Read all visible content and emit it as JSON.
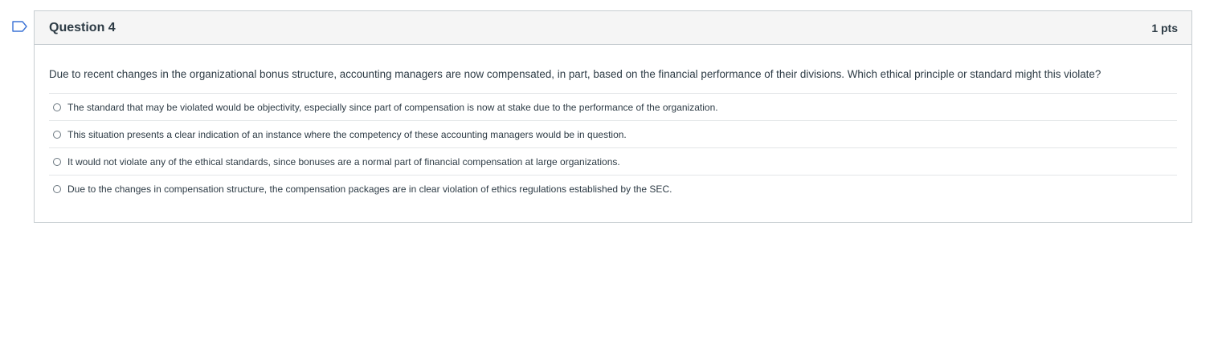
{
  "question": {
    "title": "Question 4",
    "points": "1 pts",
    "text": "Due to recent changes in the organizational bonus structure, accounting managers are now compensated, in part, based on the financial performance of their divisions. Which ethical principle or standard might this violate?",
    "answers": [
      {
        "label": "The standard that may be violated would be objectivity, especially since part of compensation is now at stake due to the performance of the organization."
      },
      {
        "label": "This situation presents a clear indication of an instance where the competency of these accounting managers would be in question."
      },
      {
        "label": "It would not violate any of the ethical standards, since bonuses are a normal part of financial compensation at large organizations."
      },
      {
        "label": "Due to the changes in compensation structure, the compensation packages are in clear violation of ethics regulations established by the SEC."
      }
    ]
  },
  "colors": {
    "flag": "#3b73d6",
    "border": "#c7cdd1",
    "header_bg": "#f5f5f5",
    "text": "#2d3b45"
  },
  "icons": {
    "flag": "flag-icon"
  }
}
